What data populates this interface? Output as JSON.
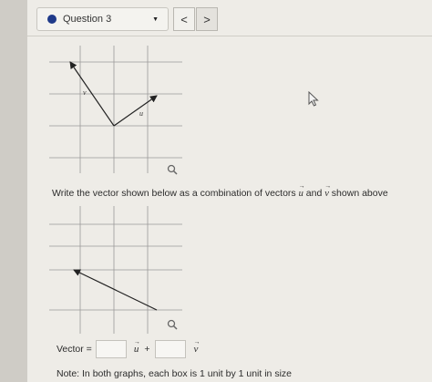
{
  "header": {
    "question_label": "Question 3",
    "prev_label": "<",
    "next_label": ">"
  },
  "graph1": {
    "vector_labels": {
      "v": "v",
      "u": "u"
    }
  },
  "instruction": {
    "prefix": "Write the vector shown below as a combination of vectors ",
    "u": "u",
    "middle": " and ",
    "v": "v",
    "suffix": " shown above"
  },
  "answer": {
    "vector_label": "Vector =",
    "plus": "+",
    "u": "u",
    "v": "v",
    "u_coefficient": "",
    "v_coefficient": ""
  },
  "note": "Note: In both graphs, each box is 1 unit by 1 unit in size",
  "colors": {
    "accent_dot": "#1f3a8a",
    "panel": "#eeece7"
  },
  "icons": [
    "chevron-down-icon",
    "magnifier-icon",
    "mouse-pointer-icon"
  ]
}
